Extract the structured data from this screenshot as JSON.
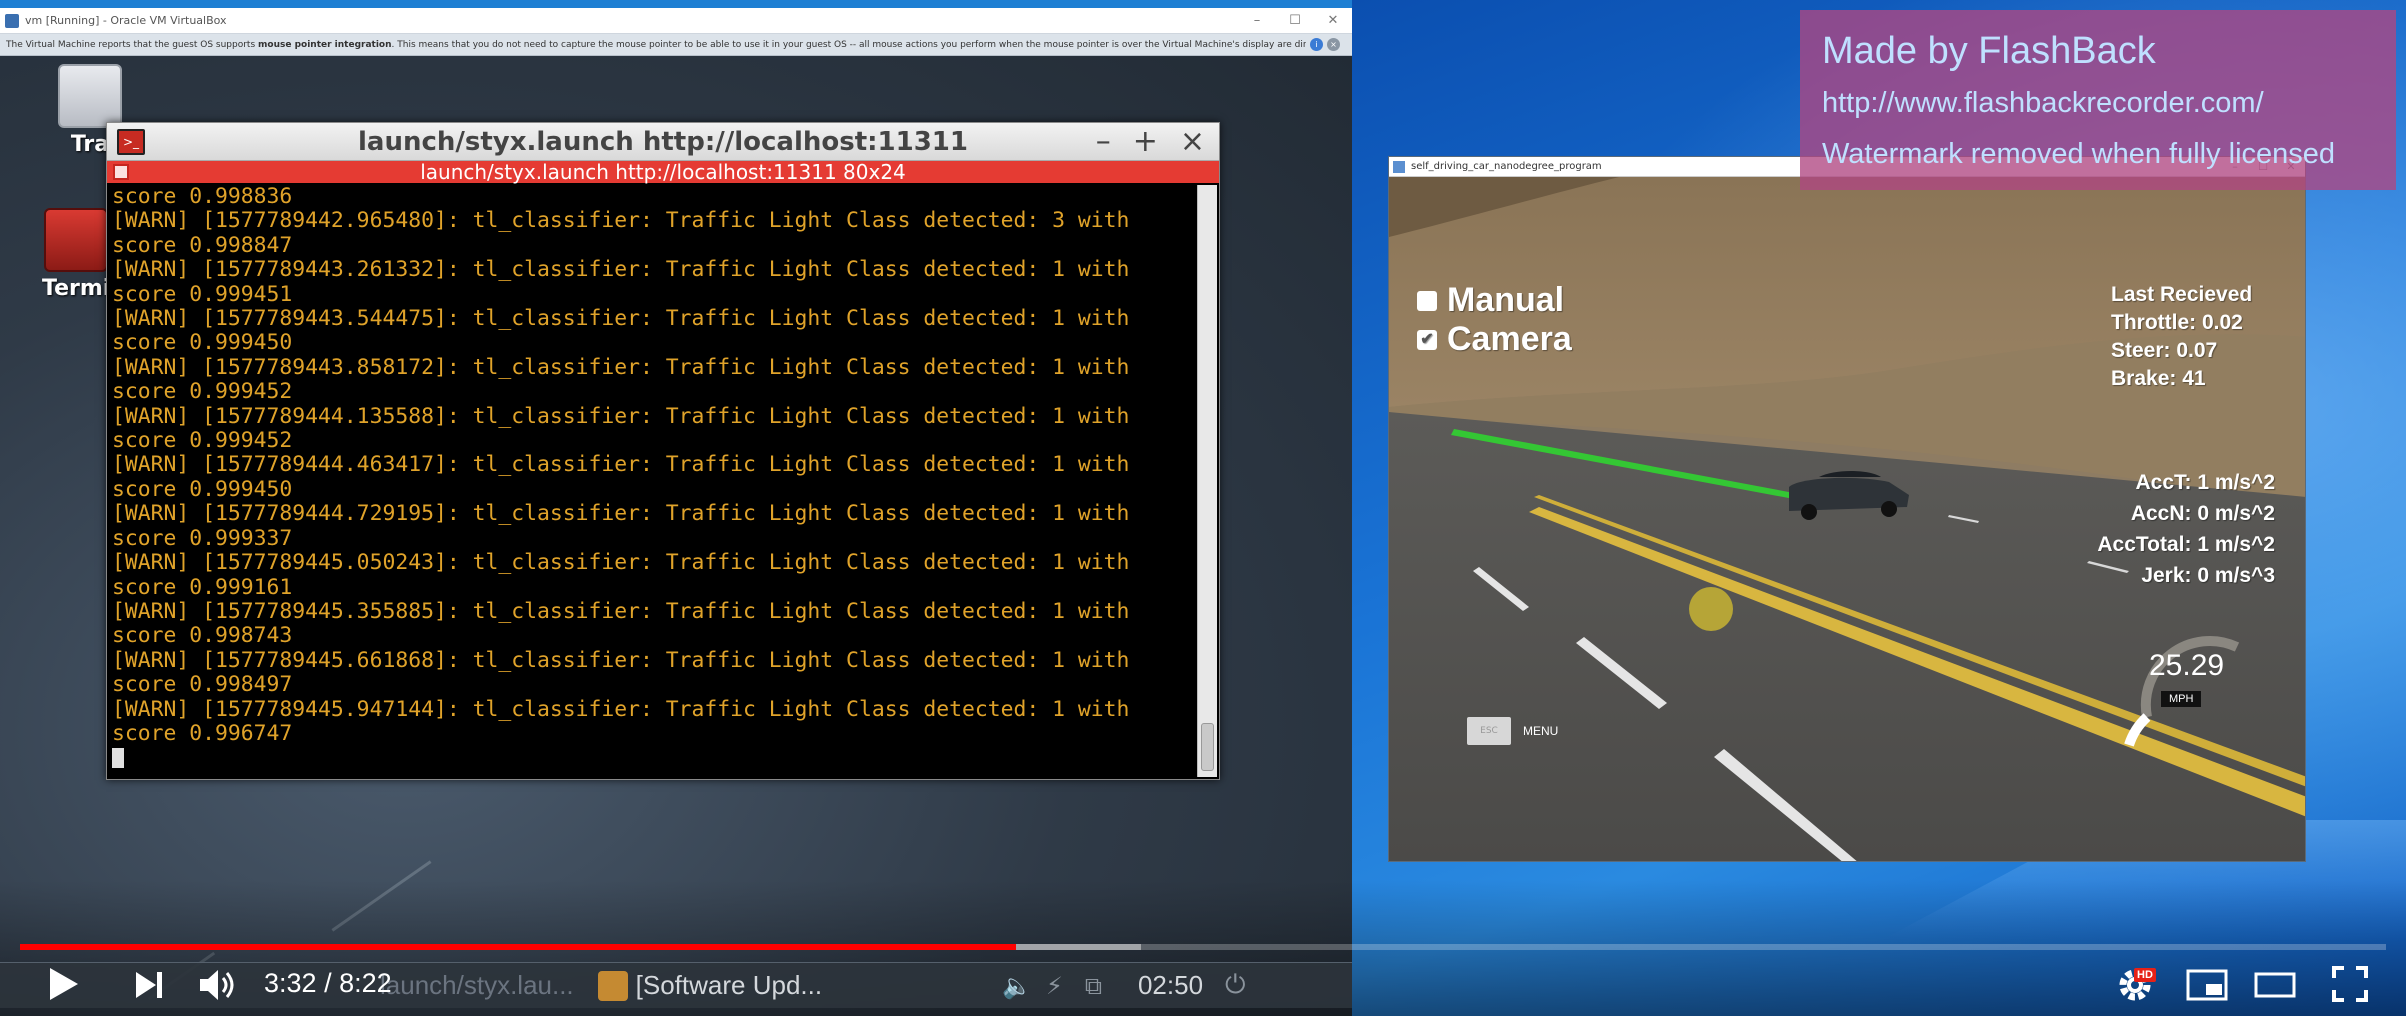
{
  "virtualbox": {
    "title": "vm [Running] - Oracle VM VirtualBox",
    "notice_pre": "The Virtual Machine reports that the guest OS supports ",
    "notice_bold": "mouse pointer integration",
    "notice_post": ". This means that you do not need to capture the mouse pointer to be able to use it in your guest OS -- all mouse actions you perform when the mouse pointer is over the Virtual Machine's display are directly sent to the guest OS. If the mouse is currently"
  },
  "desktop_icons": {
    "trash_label": "Tra",
    "terminal_label": "Termi"
  },
  "terminal": {
    "title": "launch/styx.launch http://localhost:11311",
    "tab_title": "launch/styx.launch http://localhost:11311 80x24",
    "lines": [
      "score 0.998836",
      "[WARN] [1577789442.965480]: tl_classifier: Traffic Light Class detected: 3 with",
      "score 0.998847",
      "[WARN] [1577789443.261332]: tl_classifier: Traffic Light Class detected: 1 with",
      "score 0.999451",
      "[WARN] [1577789443.544475]: tl_classifier: Traffic Light Class detected: 1 with",
      "score 0.999450",
      "[WARN] [1577789443.858172]: tl_classifier: Traffic Light Class detected: 1 with",
      "score 0.999452",
      "[WARN] [1577789444.135588]: tl_classifier: Traffic Light Class detected: 1 with",
      "score 0.999452",
      "[WARN] [1577789444.463417]: tl_classifier: Traffic Light Class detected: 1 with",
      "score 0.999450",
      "[WARN] [1577789444.729195]: tl_classifier: Traffic Light Class detected: 1 with",
      "score 0.999337",
      "[WARN] [1577789445.050243]: tl_classifier: Traffic Light Class detected: 1 with",
      "score 0.999161",
      "[WARN] [1577789445.355885]: tl_classifier: Traffic Light Class detected: 1 with",
      "score 0.998743",
      "[WARN] [1577789445.661868]: tl_classifier: Traffic Light Class detected: 1 with",
      "score 0.998497",
      "[WARN] [1577789445.947144]: tl_classifier: Traffic Light Class detected: 1 with",
      "score 0.996747"
    ]
  },
  "simulator": {
    "title": "self_driving_car_nanodegree_program",
    "manual_label": "Manual",
    "manual_checked": false,
    "camera_label": "Camera",
    "camera_checked": true,
    "last_received": "Last Recieved",
    "throttle": "Throttle: 0.02",
    "steer": "Steer: 0.07",
    "brake": "Brake: 41",
    "acct": "AccT: 1 m/s^2",
    "accn": "AccN: 0 m/s^2",
    "acctotal": "AccTotal: 1 m/s^2",
    "jerk": "Jerk: 0 m/s^3",
    "speed": "25.29",
    "speed_unit": "MPH",
    "esc_key": "ESC",
    "menu_label": "MENU"
  },
  "watermark": {
    "line1": "Made by FlashBack",
    "line2": "http://www.flashbackrecorder.com/",
    "line3": "Watermark removed when fully licensed"
  },
  "guest_taskbar": {
    "item1": "launch/styx.lau...",
    "item2": "[Software Upd...",
    "clock": "02:50"
  },
  "player": {
    "current_time": "3:32",
    "separator": " / ",
    "duration": "8:22",
    "progress_played": 0.421,
    "progress_buffered": 0.474,
    "hd_badge": "HD",
    "accent_color": "#ff0000"
  }
}
